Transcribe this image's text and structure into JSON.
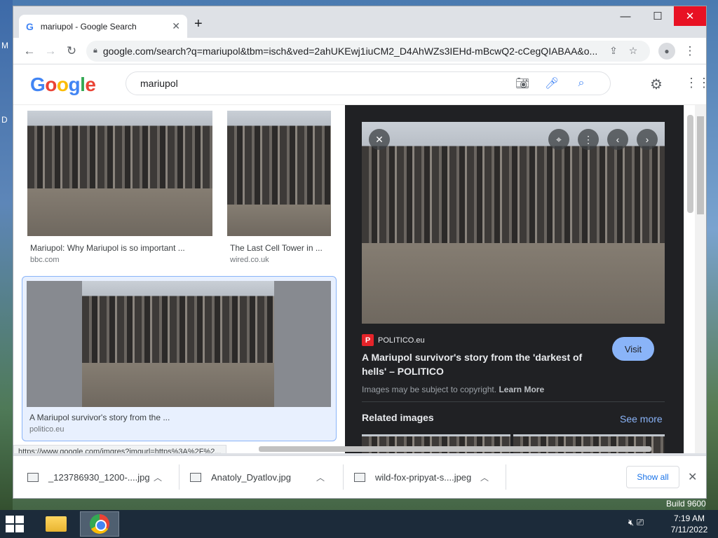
{
  "desktop": {
    "left_letters": [
      "M",
      "D"
    ],
    "build_text": "Build 9600"
  },
  "browser": {
    "tab_title": "mariupol - Google Search",
    "new_tab": "+",
    "url": "google.com/search?q=mariupol&tbm=isch&ved=2ahUKEwj1iuCM2_D4AhWZs3IEHd-mBcwQ2-cCegQIABAA&o...",
    "window_controls": {
      "minimize": "—",
      "maximize": "☐",
      "close": "✕"
    }
  },
  "google": {
    "logo": [
      "G",
      "o",
      "o",
      "g",
      "l",
      "e"
    ],
    "query": "mariupol"
  },
  "results": [
    {
      "caption": "Mariupol: Why Mariupol is so important ...",
      "source": "bbc.com"
    },
    {
      "caption": "The Last Cell Tower in ...",
      "source": "wired.co.uk"
    },
    {
      "caption": "A Mariupol survivor's story from the ...",
      "source": "politico.eu"
    }
  ],
  "panel": {
    "publisher": "POLITICO.eu",
    "publisher_letter": "P",
    "title": "A Mariupol survivor's story from the 'darkest of hells' – POLITICO",
    "visit": "Visit",
    "copyright": "Images may be subject to copyright.",
    "learn_more": "Learn More",
    "related": "Related images",
    "see_more": "See more"
  },
  "status_url": "https://www.google.com/imgres?imgurl=https%3A%2F%2...",
  "downloads": [
    {
      "name": "_123786930_1200-....jpg"
    },
    {
      "name": "Anatoly_Dyatlov.jpg"
    },
    {
      "name": "wild-fox-pripyat-s....jpeg"
    }
  ],
  "download_bar": {
    "show_all": "Show all",
    "close": "✕"
  },
  "taskbar": {
    "time": "7:19 AM",
    "date": "7/11/2022"
  },
  "colors": {
    "accent": "#8ab4f8",
    "close_red": "#e81123",
    "panel_bg": "#202124"
  }
}
